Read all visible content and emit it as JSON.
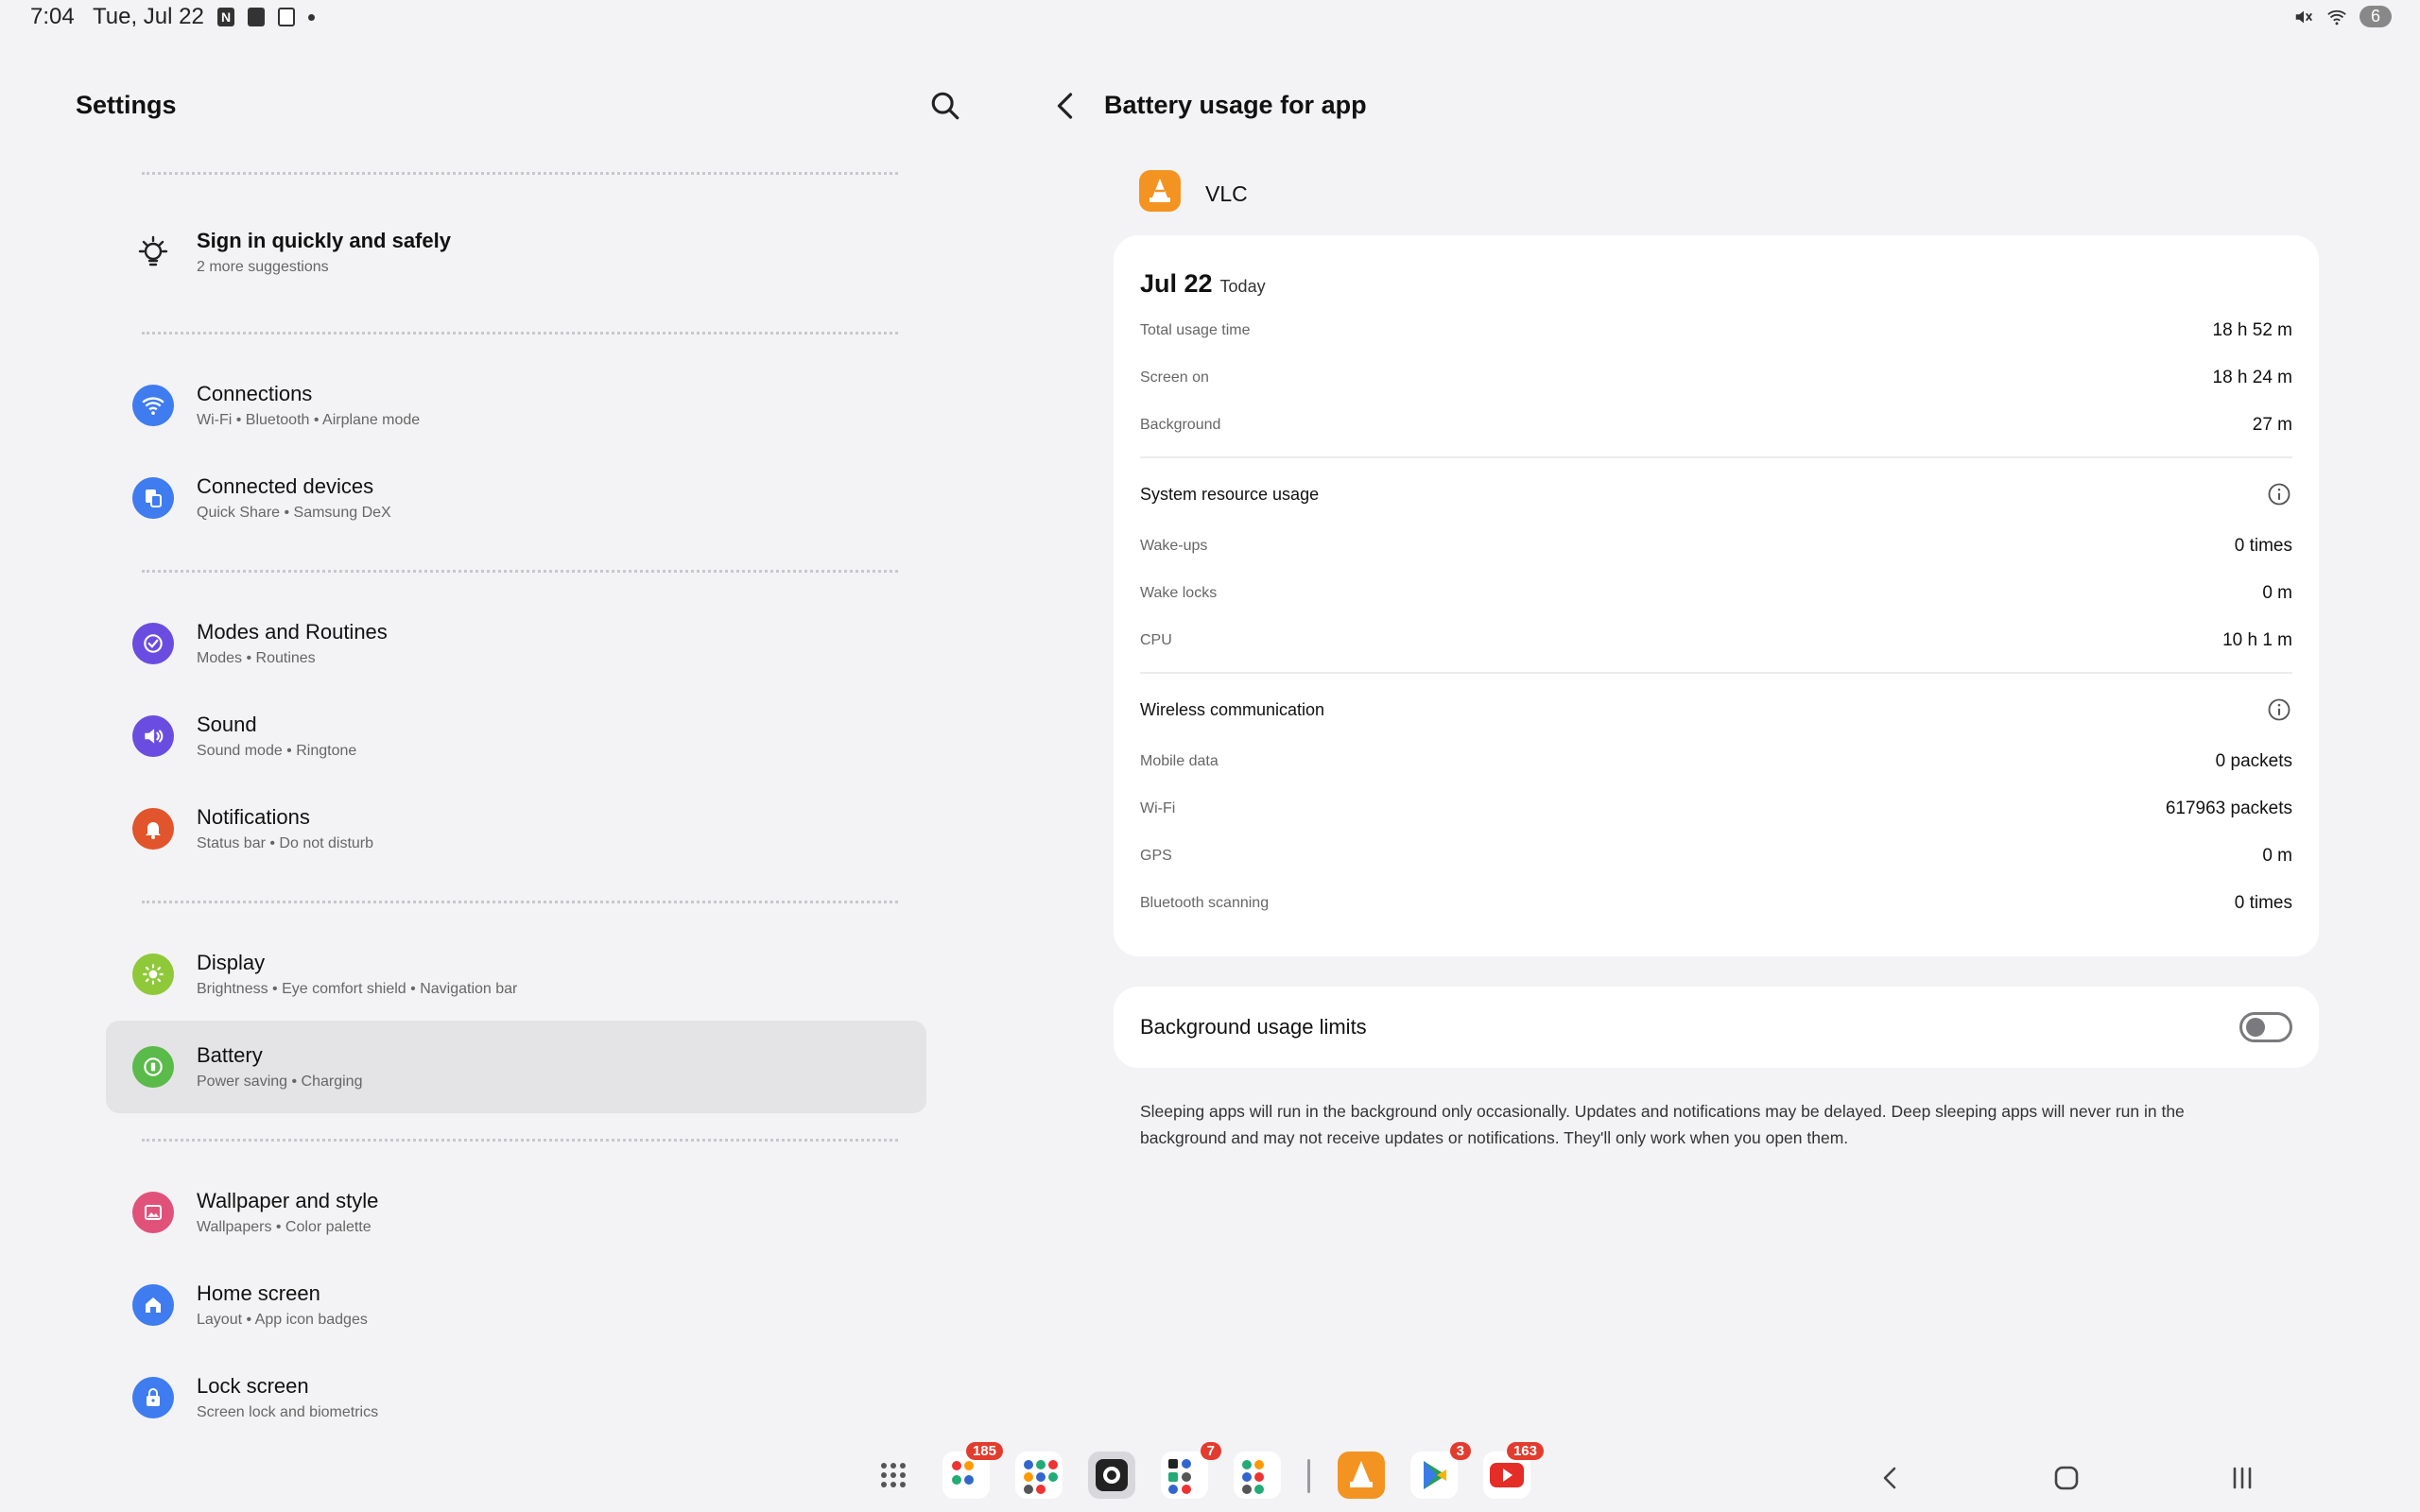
{
  "status_bar": {
    "time": "7:04",
    "date": "Tue, Jul 22",
    "notification_icons": [
      "N",
      "B",
      "calendar"
    ],
    "battery_level": "6"
  },
  "left_panel": {
    "title": "Settings",
    "suggestion": {
      "title": "Sign in quickly and safely",
      "subtitle": "2 more suggestions"
    },
    "items": [
      {
        "title": "Connections",
        "subtitle": "Wi-Fi  •  Bluetooth  •  Airplane mode",
        "icon": "wifi-icon",
        "color": "#3f7cf0"
      },
      {
        "title": "Connected devices",
        "subtitle": "Quick Share  •  Samsung DeX",
        "icon": "devices-icon",
        "color": "#3f7cf0"
      },
      {
        "title": "Modes and Routines",
        "subtitle": "Modes  •  Routines",
        "icon": "routines-icon",
        "color": "#6a4de0"
      },
      {
        "title": "Sound",
        "subtitle": "Sound mode  •  Ringtone",
        "icon": "speaker-icon",
        "color": "#6a4de0"
      },
      {
        "title": "Notifications",
        "subtitle": "Status bar  •  Do not disturb",
        "icon": "bell-icon",
        "color": "#e2542b"
      },
      {
        "title": "Display",
        "subtitle": "Brightness  •  Eye comfort shield  •  Navigation bar",
        "icon": "sun-icon",
        "color": "#8fc93a"
      },
      {
        "title": "Battery",
        "subtitle": "Power saving  •  Charging",
        "icon": "battery-icon",
        "color": "#5aba4a"
      },
      {
        "title": "Wallpaper and style",
        "subtitle": "Wallpapers  •  Color palette",
        "icon": "wallpaper-icon",
        "color": "#e0527a"
      },
      {
        "title": "Home screen",
        "subtitle": "Layout  •  App icon badges",
        "icon": "home-icon",
        "color": "#3f7cf0"
      },
      {
        "title": "Lock screen",
        "subtitle": "Screen lock and biometrics",
        "icon": "lock-icon",
        "color": "#3f7cf0"
      }
    ]
  },
  "right_panel": {
    "title": "Battery usage for app",
    "app_name": "VLC",
    "date_main": "Jul 22",
    "date_sub": "Today",
    "usage": [
      {
        "label": "Total usage time",
        "value": "18 h 52 m"
      },
      {
        "label": "Screen on",
        "value": "18 h 24 m"
      },
      {
        "label": "Background",
        "value": "27 m"
      }
    ],
    "system_title": "System resource usage",
    "system": [
      {
        "label": "Wake-ups",
        "value": "0 times"
      },
      {
        "label": "Wake locks",
        "value": "0 m"
      },
      {
        "label": "CPU",
        "value": "10 h 1 m"
      }
    ],
    "wireless_title": "Wireless communication",
    "wireless": [
      {
        "label": "Mobile data",
        "value": "0 packets"
      },
      {
        "label": "Wi-Fi",
        "value": "617963 packets"
      },
      {
        "label": "GPS",
        "value": "0 m"
      },
      {
        "label": "Bluetooth scanning",
        "value": "0 times"
      }
    ],
    "background_limits_label": "Background usage limits",
    "background_limits_on": false,
    "note": "Sleeping apps will run in the background only occasionally. Updates and notifications may be delayed. Deep sleeping apps will never run in the background and may not receive updates or notifications. They'll only work when you open them."
  },
  "taskbar": {
    "badges": {
      "folder1": "185",
      "folder3": "7",
      "play_store": "3",
      "youtube": "163"
    }
  }
}
